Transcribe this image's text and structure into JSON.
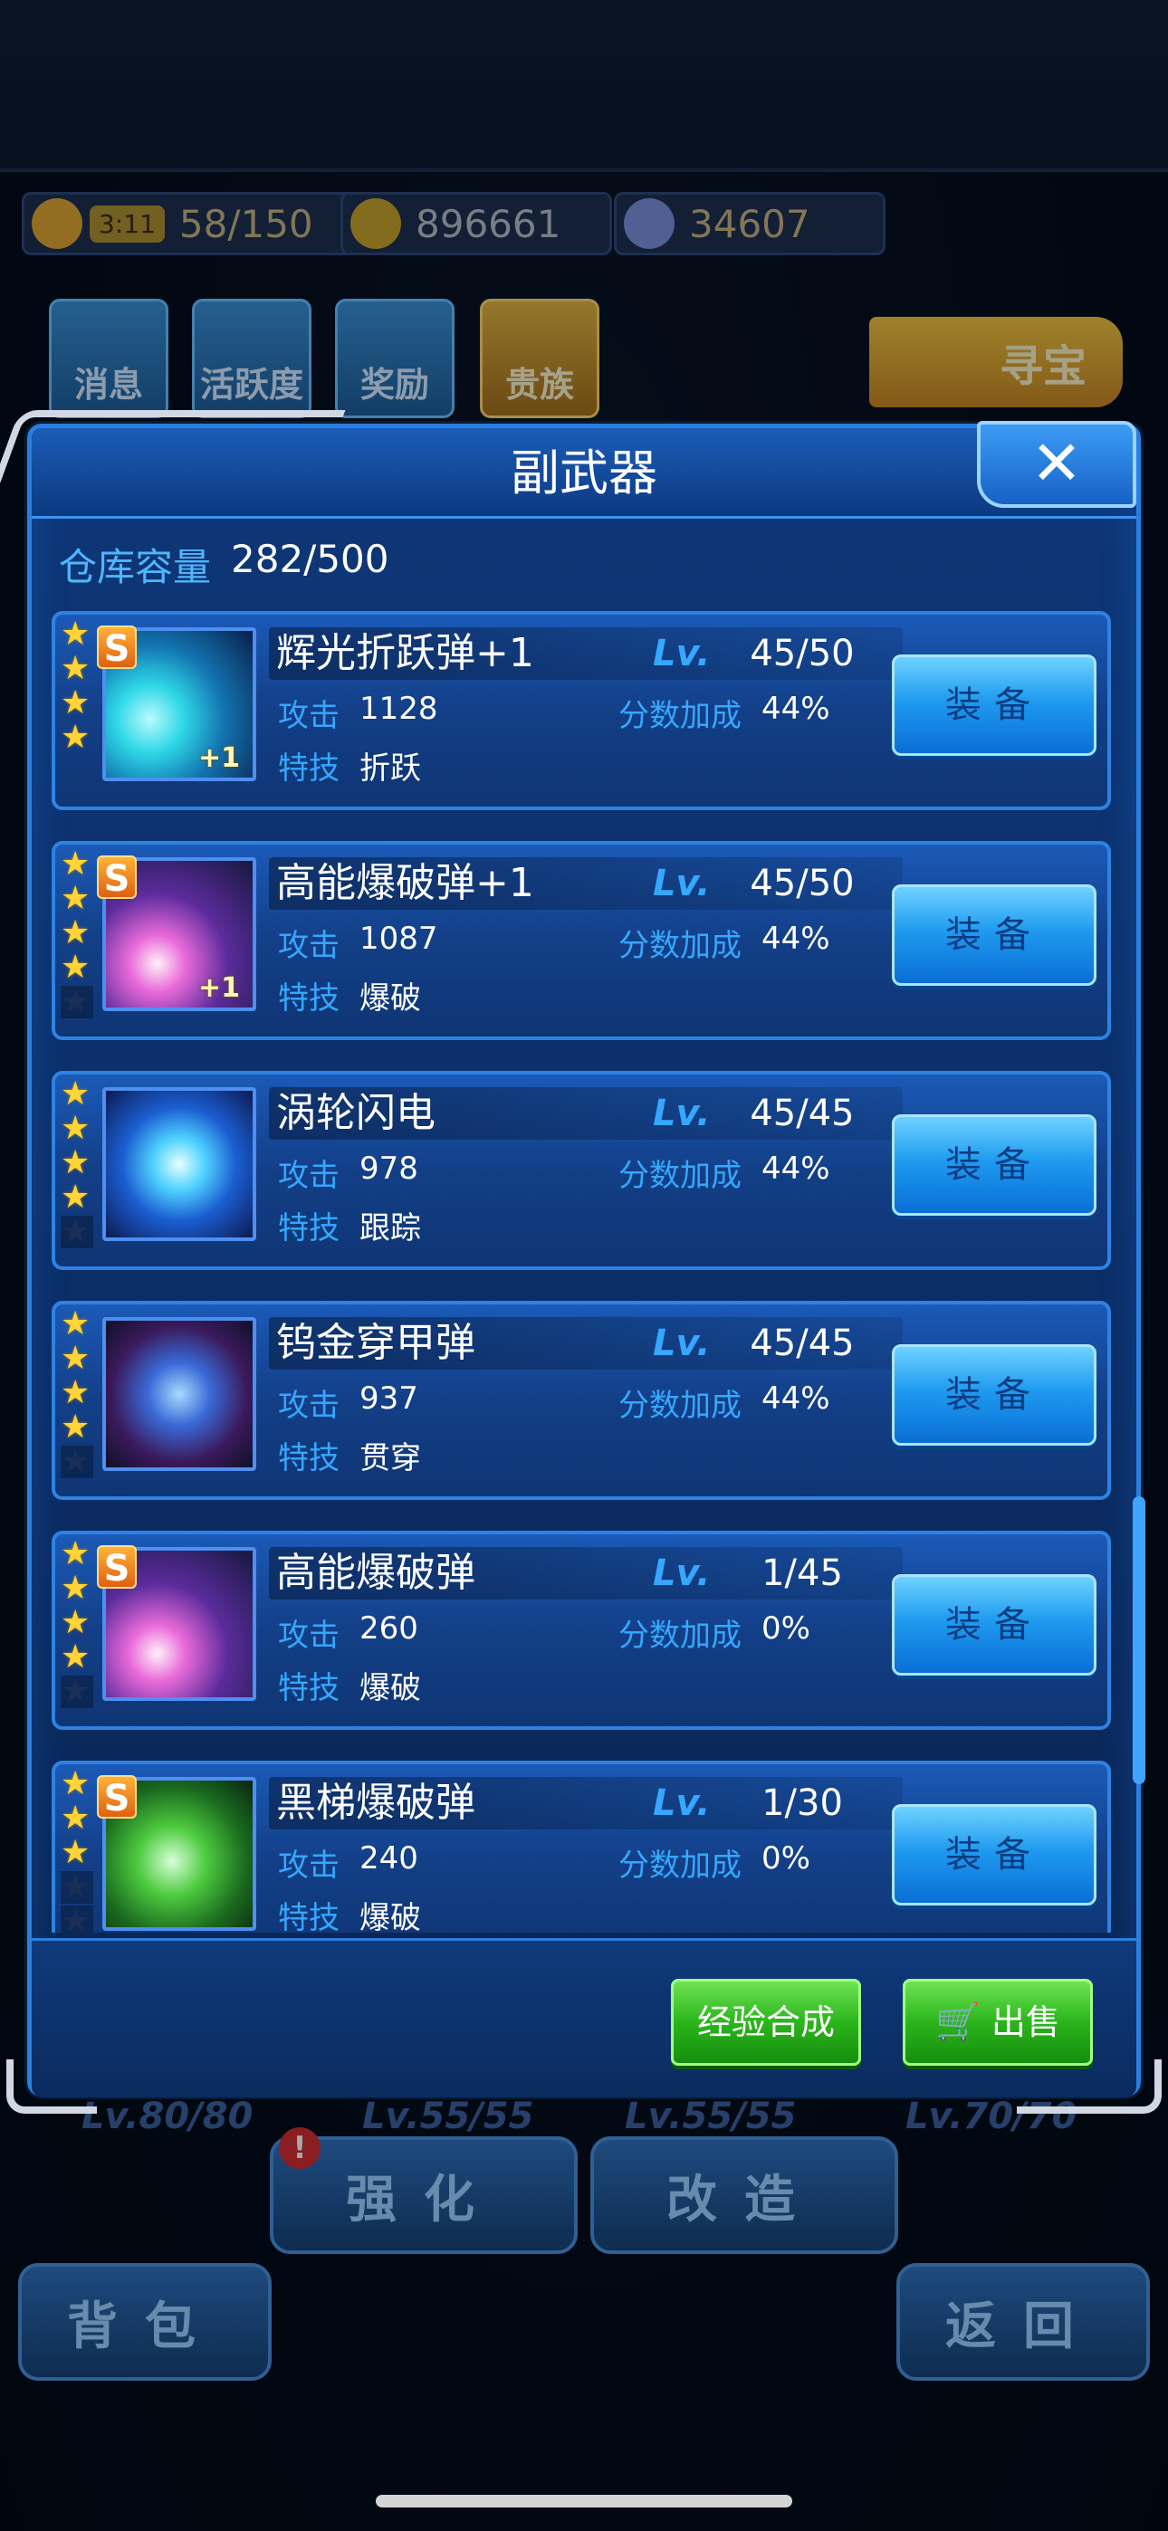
{
  "background": {
    "energy_timer": "3:11",
    "energy": "58/150",
    "gold": "896661",
    "diamonds": "34607",
    "top_buttons": [
      "消息",
      "活跃度",
      "奖励",
      "贵族"
    ],
    "treasure_label": "寻宝",
    "bottom_levels": [
      "Lv.80/80",
      "Lv.55/55",
      "Lv.55/55",
      "Lv.70/70"
    ],
    "alert": "!",
    "strengthen_label": "强化",
    "modify_label": "改造",
    "bag_label": "背包",
    "back_label": "返回"
  },
  "dialog": {
    "title": "副武器",
    "close_icon": "close-icon",
    "capacity_label": "仓库容量",
    "capacity_value": "282/500",
    "items": [
      {
        "name": "辉光折跃弹+1",
        "lv_label": "Lv.",
        "lv": "45/50",
        "attack_label": "攻击",
        "attack": "1128",
        "bonus_label": "分数加成",
        "bonus": "44%",
        "skill_label": "特技",
        "skill": "折跃",
        "rank": "S",
        "plus": "+1",
        "equip": "装备"
      },
      {
        "name": "高能爆破弹+1",
        "lv_label": "Lv.",
        "lv": "45/50",
        "attack_label": "攻击",
        "attack": "1087",
        "bonus_label": "分数加成",
        "bonus": "44%",
        "skill_label": "特技",
        "skill": "爆破",
        "rank": "S",
        "plus": "+1",
        "equip": "装备"
      },
      {
        "name": "涡轮闪电",
        "lv_label": "Lv.",
        "lv": "45/45",
        "attack_label": "攻击",
        "attack": "978",
        "bonus_label": "分数加成",
        "bonus": "44%",
        "skill_label": "特技",
        "skill": "跟踪",
        "rank": "",
        "plus": "",
        "equip": "装备"
      },
      {
        "name": "钨金穿甲弹",
        "lv_label": "Lv.",
        "lv": "45/45",
        "attack_label": "攻击",
        "attack": "937",
        "bonus_label": "分数加成",
        "bonus": "44%",
        "skill_label": "特技",
        "skill": "贯穿",
        "rank": "",
        "plus": "",
        "equip": "装备"
      },
      {
        "name": "高能爆破弹",
        "lv_label": "Lv.",
        "lv": "1/45",
        "attack_label": "攻击",
        "attack": "260",
        "bonus_label": "分数加成",
        "bonus": "0%",
        "skill_label": "特技",
        "skill": "爆破",
        "rank": "S",
        "plus": "",
        "equip": "装备"
      },
      {
        "name": "黑梯爆破弹",
        "lv_label": "Lv.",
        "lv": "1/30",
        "attack_label": "攻击",
        "attack": "240",
        "bonus_label": "分数加成",
        "bonus": "0%",
        "skill_label": "特技",
        "skill": "爆破",
        "rank": "S",
        "plus": "",
        "equip": "装备"
      }
    ],
    "exp_merge_label": "经验合成",
    "sell_label": "出售"
  }
}
